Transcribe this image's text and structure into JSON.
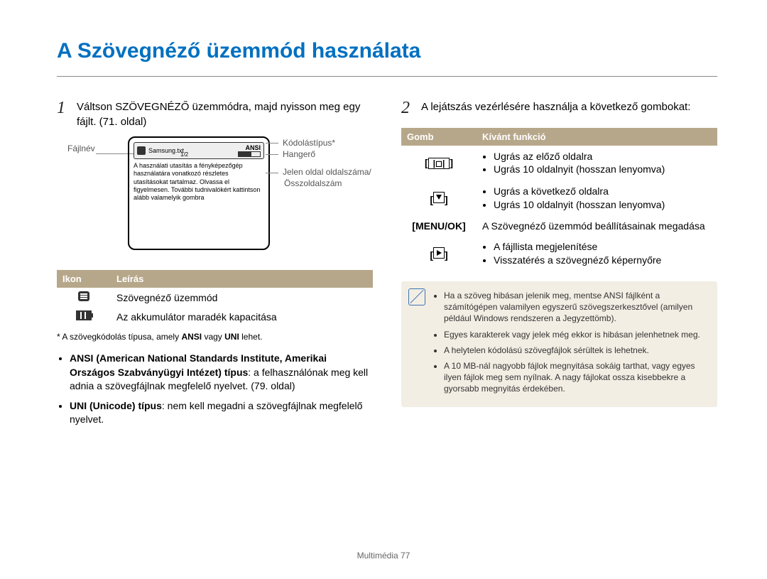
{
  "title": "A Szövegnéző üzemmód használata",
  "left": {
    "step_num": "1",
    "step_text": "Váltson SZÖVEGNÉZŐ üzemmódra, majd nyisson meg egy fájlt. (71. oldal)",
    "shot": {
      "filename_label": "Fájlnév",
      "filename": "Samsung.txt",
      "pages": "1/2",
      "ansi": "ANSI",
      "body": "A használati utasítás a fényképezőgép használatára vonatkozó részletes utasításokat tartalmaz. Olvassa el figyelmesen. További tudnivalókért kattintson alább valamelyik gombra",
      "right_labels": {
        "l1": "Kódolástípus*",
        "l2": "Hangerő",
        "l3": "Jelen oldal oldalszáma/Összoldalszám"
      }
    },
    "icon_table": {
      "head_icon": "Ikon",
      "head_desc": "Leírás",
      "r1": "Szövegnéző üzemmód",
      "r2": "Az akkumulátor maradék kapacitása"
    },
    "footnote_prefix": "* A szövegkódolás típusa, amely ",
    "footnote_mid": " vagy ",
    "footnote_suffix": " lehet.",
    "ansi_b": "ANSI",
    "uni_b": "UNI",
    "bullets": {
      "b1_strong": "ANSI (American National Standards Institute, Amerikai Országos Szabványügyi Intézet) típus",
      "b1_rest": ": a felhasználónak meg kell adnia a szövegfájlnak megfelelő nyelvet. (79. oldal)",
      "b2_strong": "UNI (Unicode) típus",
      "b2_rest": ": nem kell megadni a szövegfájlnak megfelelő nyelvet."
    }
  },
  "right": {
    "step_num": "2",
    "step_text": "A lejátszás vezérlésére használja a következő gombokat:",
    "ctrl": {
      "head_btn": "Gomb",
      "head_fn": "Kívánt funkció",
      "r1b": "[ |◻| ]",
      "r1_1": "Ugrás az előző oldalra",
      "r1_2": "Ugrás 10 oldalnyit (hosszan lenyomva)",
      "r2_1": "Ugrás a következő oldalra",
      "r2_2": "Ugrás 10 oldalnyit (hosszan lenyomva)",
      "r3b": "[MENU/OK]",
      "r3": "A Szövegnéző üzemmód beállításainak megadása",
      "r4_1": "A fájllista megjelenítése",
      "r4_2": "Visszatérés a szövegnéző képernyőre"
    },
    "notes": {
      "n1": "Ha a szöveg hibásan jelenik meg, mentse ANSI fájlként a számítógépen valamilyen egyszerű szövegszerkesztővel (amilyen például Windows rendszeren a Jegyzettömb).",
      "n2": "Egyes karakterek vagy jelek még ekkor is hibásan jelenhetnek meg.",
      "n3": "A helytelen kódolású szövegfájlok sérültek is lehetnek.",
      "n4": "A 10 MB-nál nagyobb fájlok megnyitása sokáig tarthat, vagy egyes ilyen fájlok meg sem nyílnak. A nagy fájlokat ossza kisebbekre a gyorsabb megnyitás érdekében."
    }
  },
  "footer": "Multimédia  77"
}
